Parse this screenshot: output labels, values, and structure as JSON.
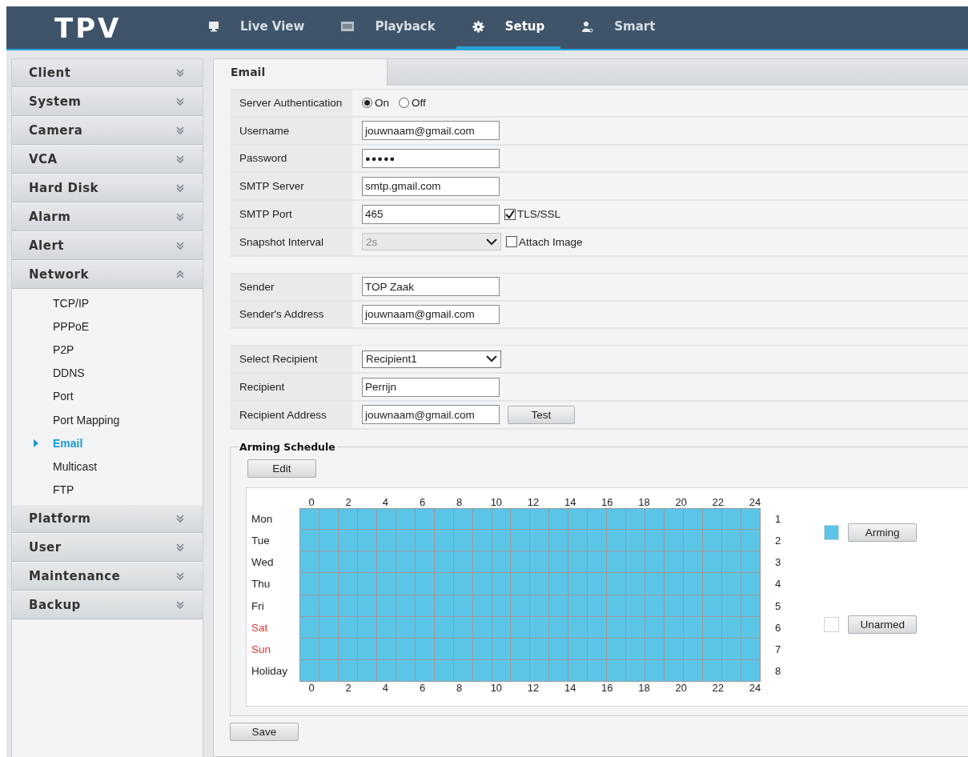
{
  "header": {
    "logo": "TPV",
    "nav": [
      {
        "label": "Live View",
        "selected": false
      },
      {
        "label": "Playback",
        "selected": false
      },
      {
        "label": "Setup",
        "selected": true
      },
      {
        "label": "Smart",
        "selected": false
      }
    ]
  },
  "sidebar": {
    "sections": [
      {
        "label": "Client",
        "expanded": false
      },
      {
        "label": "System",
        "expanded": false
      },
      {
        "label": "Camera",
        "expanded": false
      },
      {
        "label": "VCA",
        "expanded": false
      },
      {
        "label": "Hard Disk",
        "expanded": false
      },
      {
        "label": "Alarm",
        "expanded": false
      },
      {
        "label": "Alert",
        "expanded": false
      },
      {
        "label": "Network",
        "expanded": true,
        "items": [
          {
            "label": "TCP/IP",
            "selected": false
          },
          {
            "label": "PPPoE",
            "selected": false
          },
          {
            "label": "P2P",
            "selected": false
          },
          {
            "label": "DDNS",
            "selected": false
          },
          {
            "label": "Port",
            "selected": false
          },
          {
            "label": "Port Mapping",
            "selected": false
          },
          {
            "label": "Email",
            "selected": true
          },
          {
            "label": "Multicast",
            "selected": false
          },
          {
            "label": "FTP",
            "selected": false
          }
        ]
      },
      {
        "label": "Platform",
        "expanded": false
      },
      {
        "label": "User",
        "expanded": false
      },
      {
        "label": "Maintenance",
        "expanded": false
      },
      {
        "label": "Backup",
        "expanded": false
      }
    ]
  },
  "content": {
    "tab": "Email",
    "groups": [
      [
        {
          "label": "Server Authentication",
          "kind": "radio",
          "options": [
            {
              "label": "On",
              "selected": true
            },
            {
              "label": "Off",
              "selected": false
            }
          ]
        },
        {
          "label": "Username",
          "kind": "text",
          "value": "jouwnaam@gmail.com"
        },
        {
          "label": "Password",
          "kind": "password",
          "value": "●●●●●"
        },
        {
          "label": "SMTP Server",
          "kind": "text",
          "value": "smtp.gmail.com"
        },
        {
          "label": "SMTP Port",
          "kind": "text",
          "value": "465",
          "checkbox": {
            "label": "TLS/SSL",
            "checked": true
          }
        },
        {
          "label": "Snapshot Interval",
          "kind": "select",
          "value": "2s",
          "disabled": true,
          "checkbox": {
            "label": "Attach Image",
            "checked": false
          }
        }
      ],
      [
        {
          "label": "Sender",
          "kind": "text",
          "value": "TOP Zaak"
        },
        {
          "label": "Sender's Address",
          "kind": "text",
          "value": "jouwnaam@gmail.com"
        }
      ],
      [
        {
          "label": "Select Recipient",
          "kind": "select",
          "value": "Recipient1",
          "disabled": false
        },
        {
          "label": "Recipient",
          "kind": "text",
          "value": "Perrijn"
        },
        {
          "label": "Recipient Address",
          "kind": "text",
          "value": "jouwnaam@gmail.com",
          "button": "Test"
        }
      ]
    ],
    "schedule": {
      "title": "Arming Schedule",
      "edit_button": "Edit",
      "top_ticks": [
        "0",
        "2",
        "4",
        "6",
        "8",
        "10",
        "12",
        "14",
        "16",
        "18",
        "20",
        "22",
        "24"
      ],
      "bottom_ticks": [
        "0",
        "2",
        "4",
        "6",
        "8",
        "10",
        "12",
        "14",
        "16",
        "18",
        "20",
        "22",
        "24"
      ],
      "days": [
        {
          "label": "Mon",
          "number": "1",
          "weekend": false,
          "armed": true
        },
        {
          "label": "Tue",
          "number": "2",
          "weekend": false,
          "armed": true
        },
        {
          "label": "Wed",
          "number": "3",
          "weekend": false,
          "armed": true
        },
        {
          "label": "Thu",
          "number": "4",
          "weekend": false,
          "armed": true
        },
        {
          "label": "Fri",
          "number": "5",
          "weekend": false,
          "armed": true
        },
        {
          "label": "Sat",
          "number": "6",
          "weekend": true,
          "armed": true
        },
        {
          "label": "Sun",
          "number": "7",
          "weekend": true,
          "armed": true
        },
        {
          "label": "Holiday",
          "number": "8",
          "weekend": false,
          "armed": true
        }
      ],
      "legend": [
        {
          "label": "Arming",
          "color": "#5bc5e8"
        },
        {
          "label": "Unarmed",
          "color": "#ffffff"
        }
      ]
    },
    "save_button": "Save"
  }
}
